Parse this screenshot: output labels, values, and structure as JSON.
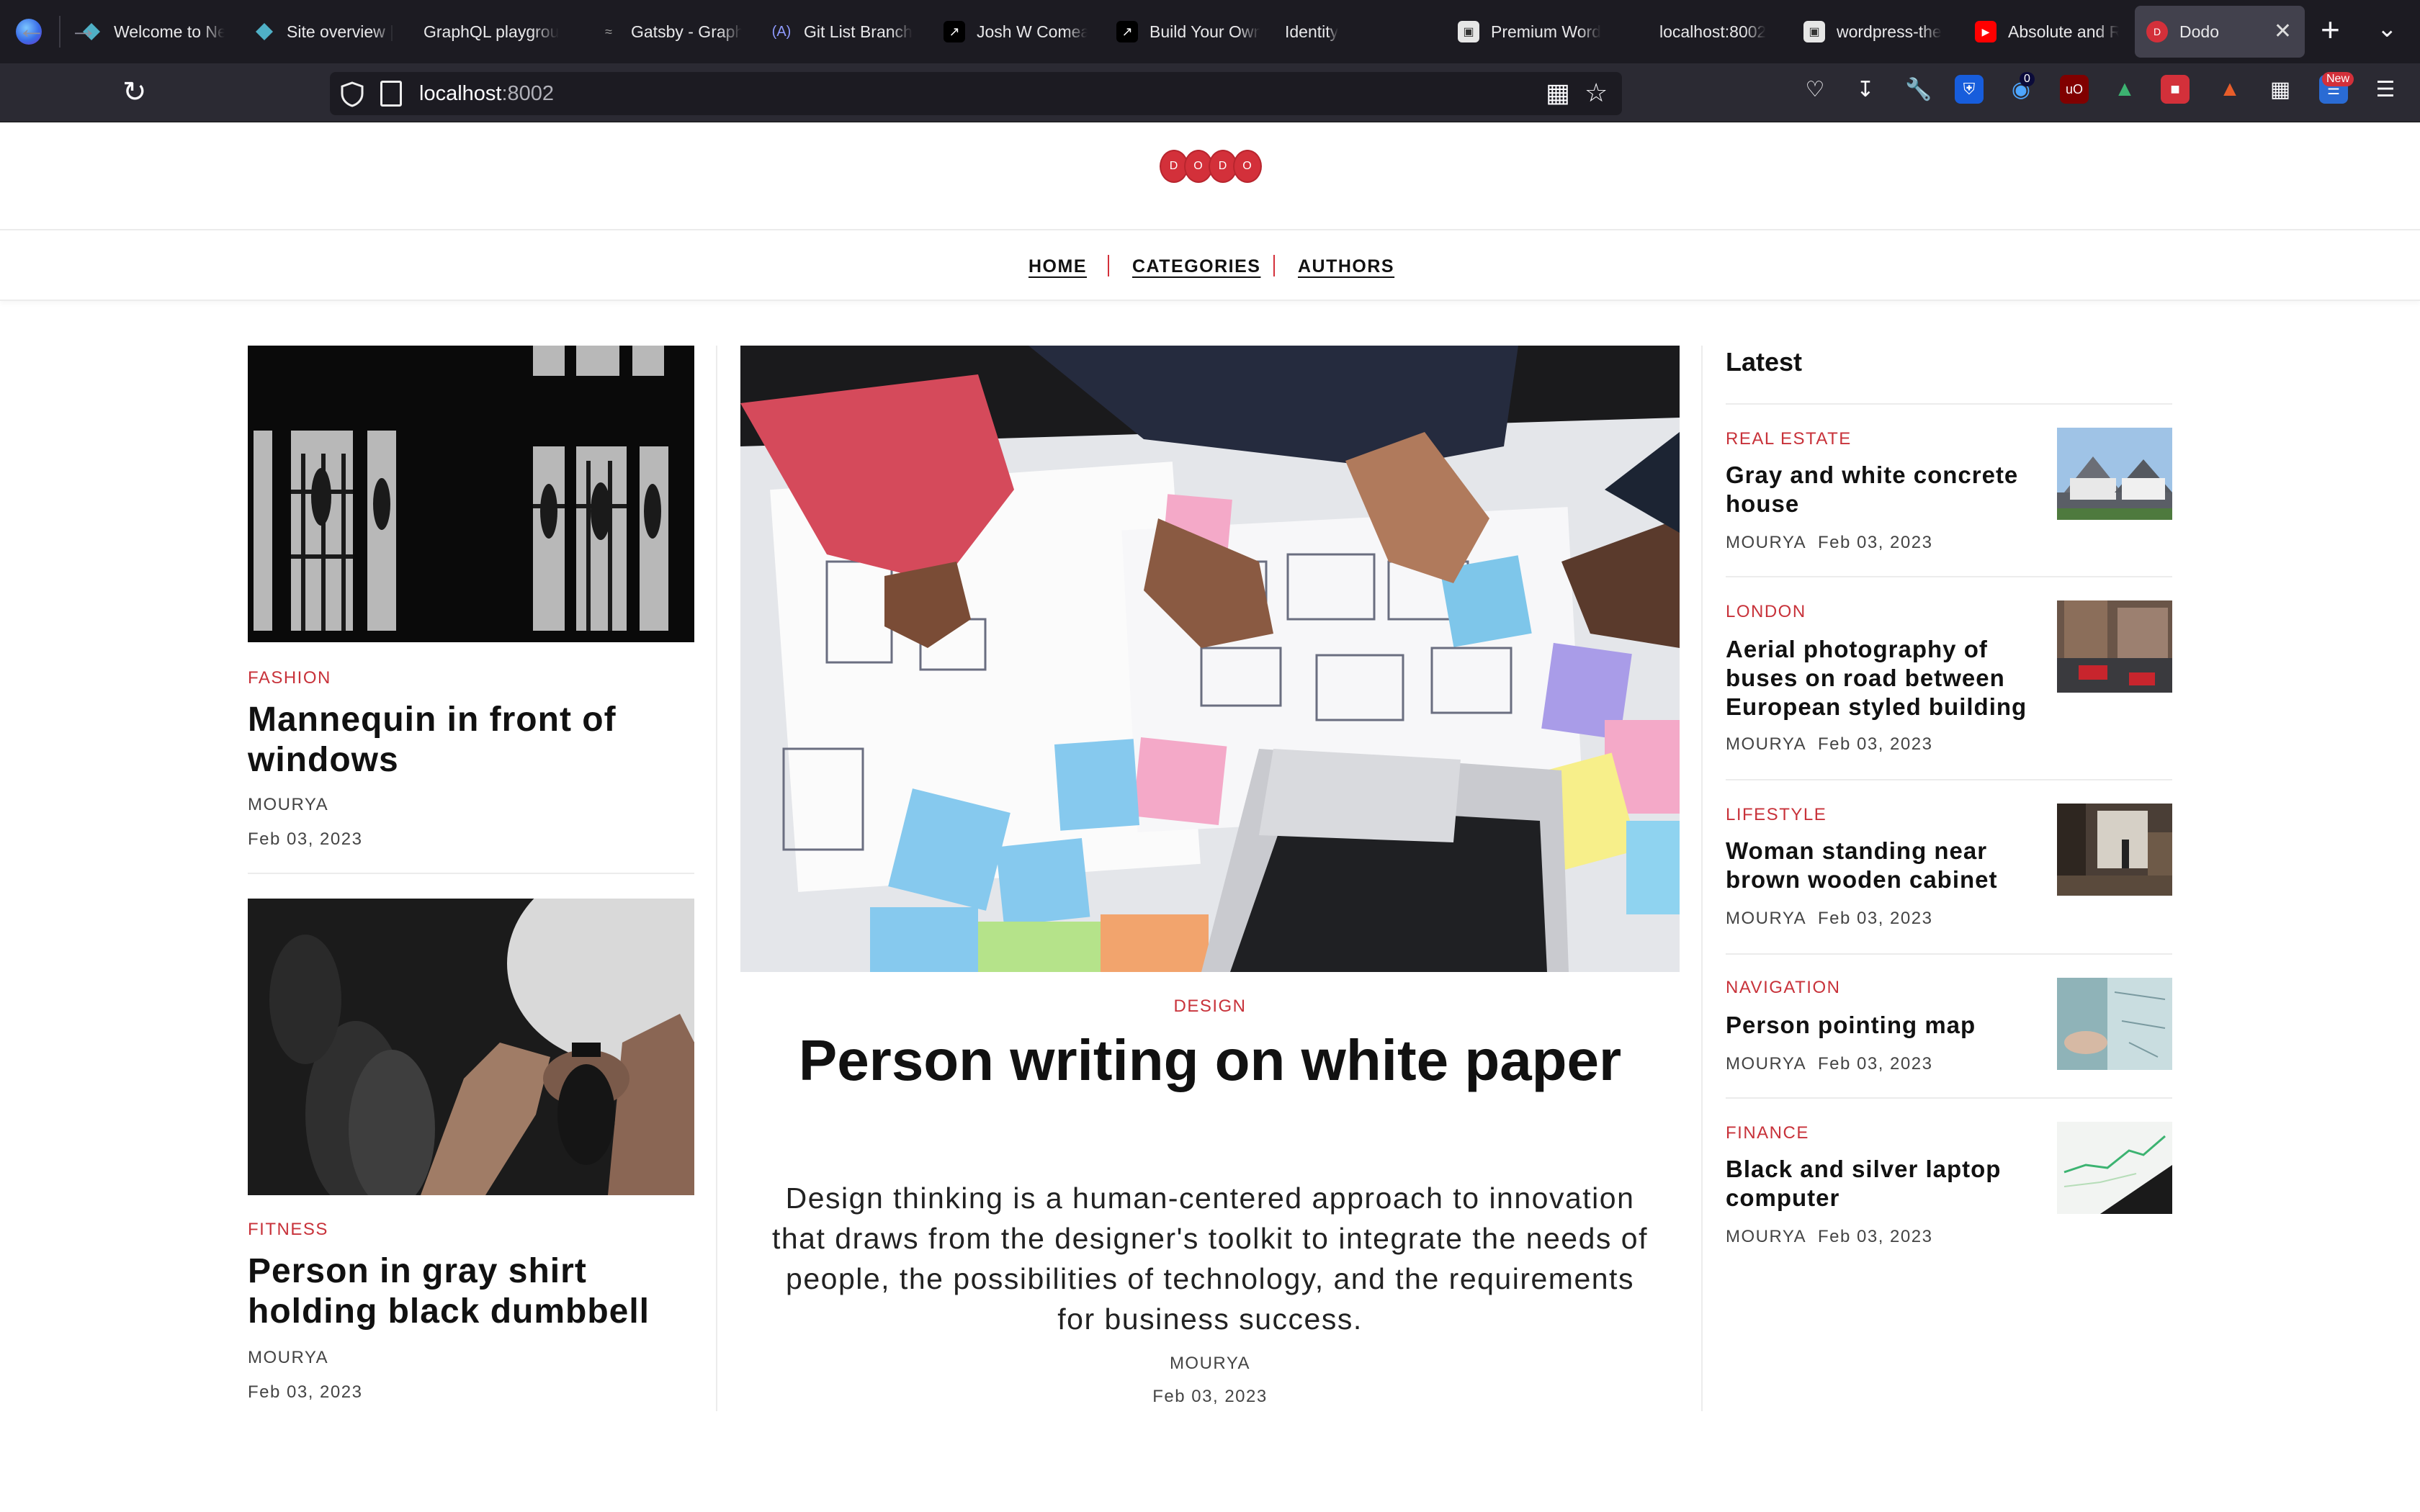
{
  "browser": {
    "tabs": [
      {
        "label": "Welcome to Ne",
        "icon": "diamond-icon",
        "color": "#4fb0c6"
      },
      {
        "label": "Site overview |",
        "icon": "diamond-icon",
        "color": "#4fb0c6"
      },
      {
        "label": "GraphQL playgrou",
        "icon": "",
        "color": ""
      },
      {
        "label": "Gatsby - Graph",
        "icon": "gatsby-icon",
        "color": "#9a9a9a"
      },
      {
        "label": "Git List Branch",
        "icon": "code-icon",
        "color": "#6f7cf5"
      },
      {
        "label": "Josh W Comea",
        "icon": "arrow-icon",
        "color": "#000000"
      },
      {
        "label": "Build Your Own",
        "icon": "arrow-icon",
        "color": "#000000"
      },
      {
        "label": "Identity",
        "icon": "",
        "color": ""
      },
      {
        "label": "Premium Word",
        "icon": "page-icon",
        "color": "#dddddd"
      },
      {
        "label": "localhost:8002",
        "icon": "",
        "color": ""
      },
      {
        "label": "wordpress-the",
        "icon": "page-icon",
        "color": "#dddddd"
      },
      {
        "label": "Absolute and R",
        "icon": "youtube-icon",
        "color": "#ff0000"
      },
      {
        "label": "Dodo",
        "icon": "dodo-icon",
        "color": "#d3303a"
      }
    ],
    "url_host": "localhost",
    "url_port": ":8002",
    "toolbar_badges": {
      "notifications": "0",
      "new": "New"
    }
  },
  "site": {
    "logo_letters": [
      "D",
      "O",
      "D",
      "O"
    ],
    "nav": [
      "HOME",
      "CATEGORIES",
      "AUTHORS"
    ]
  },
  "left_posts": [
    {
      "category": "FASHION",
      "title": "Mannequin in front of windows",
      "author": "MOURYA",
      "date": "Feb 03, 2023"
    },
    {
      "category": "FITNESS",
      "title": "Person in gray shirt holding black dumbbell",
      "author": "MOURYA",
      "date": "Feb 03, 2023"
    }
  ],
  "featured": {
    "category": "DESIGN",
    "title": "Person writing on white paper",
    "excerpt": "Design thinking is a human-centered approach to innovation that draws from the designer's toolkit to integrate the needs of people, the possibilities of technology, and the requirements for business success.",
    "author": "MOURYA",
    "date": "Feb 03, 2023"
  },
  "sidebar": {
    "heading": "Latest",
    "posts": [
      {
        "category": "REAL ESTATE",
        "title": "Gray and white concrete house",
        "author": "MOURYA",
        "date": "Feb 03, 2023"
      },
      {
        "category": "LONDON",
        "title": "Aerial photography of buses on road between European styled building",
        "author": "MOURYA",
        "date": "Feb 03, 2023"
      },
      {
        "category": "LIFESTYLE",
        "title": "Woman standing near brown wooden cabinet",
        "author": "MOURYA",
        "date": "Feb 03, 2023"
      },
      {
        "category": "NAVIGATION",
        "title": "Person pointing map",
        "author": "MOURYA",
        "date": "Feb 03, 2023"
      },
      {
        "category": "FINANCE",
        "title": "Black and silver laptop computer",
        "author": "MOURYA",
        "date": "Feb 03, 2023"
      }
    ]
  },
  "colors": {
    "accent": "#d3303a",
    "chrome_bg": "#1c1b22",
    "toolbar_bg": "#2b2a33"
  }
}
